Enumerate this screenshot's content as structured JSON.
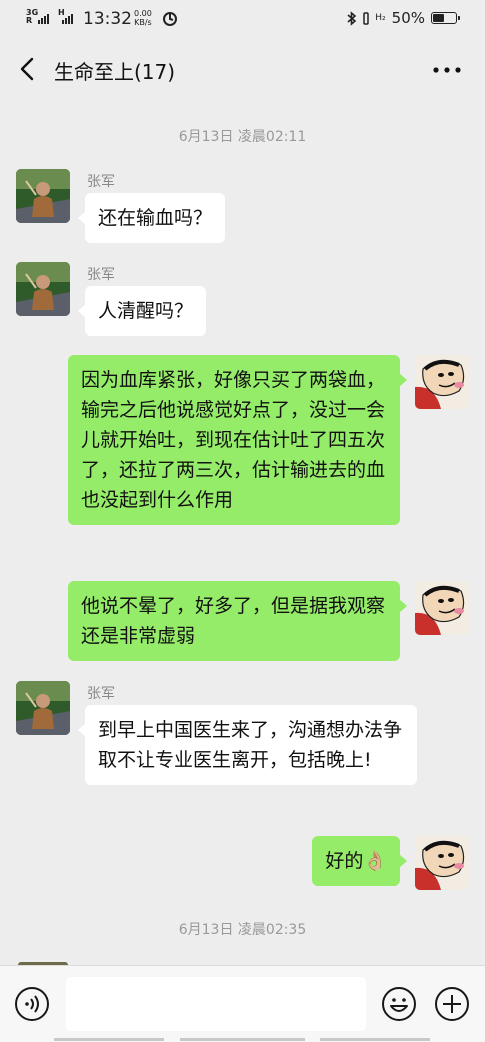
{
  "status": {
    "network_top": "3G",
    "network_bottom": "R",
    "network2": "H",
    "time": "13:32",
    "speed_value": "0.00",
    "speed_unit": "KB/s",
    "signal_bottom": "H₂",
    "battery": "50%",
    "battery_level": 0.5
  },
  "header": {
    "title": "生命至上(17)"
  },
  "messages": [
    {
      "type": "time",
      "text": "6月13日 凌晨02:11"
    },
    {
      "type": "in",
      "sender": "张军",
      "text": "还在输血吗？"
    },
    {
      "type": "in",
      "sender": "张军",
      "text": "人清醒吗？"
    },
    {
      "type": "out",
      "text": "因为血库紧张，好像只买了两袋血，输完之后他说感觉好点了，没过一会儿就开始吐，到现在估计吐了四五次了，还拉了两三次，估计输进去的血也没起到什么作用"
    },
    {
      "type": "out",
      "text": "他说不晕了，好多了，但是据我观察还是非常虚弱"
    },
    {
      "type": "in",
      "sender": "张军",
      "text": "到早上中国医生来了，沟通想办法争取不让专业医生离开，包括晚上!"
    },
    {
      "type": "out",
      "text": "好的👌🏼"
    },
    {
      "type": "time",
      "text": "6月13日 凌晨02:35"
    }
  ],
  "icons": {
    "back": "chevron-left-icon",
    "more": "more-dots-icon",
    "voice": "voice-icon",
    "emoji": "emoji-icon",
    "add": "add-icon"
  },
  "colors": {
    "background": "#ededed",
    "outgoing_bubble": "#95ec69",
    "incoming_bubble": "#ffffff"
  }
}
